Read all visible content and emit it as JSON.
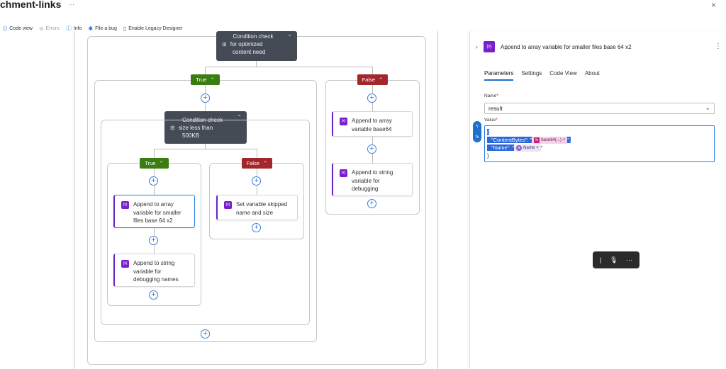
{
  "header": {
    "title": "chment-links",
    "more": "···",
    "close": "×"
  },
  "toolbar": {
    "code_view": "Code view",
    "errors": "Errors",
    "info": "Info",
    "file_bug": "File a bug",
    "legacy": "Enable Legacy Designer"
  },
  "canvas": {
    "cond_optimized": [
      "Condition check",
      "for optimized",
      "content need"
    ],
    "cond_size": [
      "Condition check",
      "size less than",
      "500KB"
    ],
    "badge_true": "True",
    "badge_false": "False",
    "append_array_base64": [
      "Append to array",
      "variable base64"
    ],
    "append_string_debugging": [
      "Append to string",
      "variable for",
      "debugging"
    ],
    "append_smaller": [
      "Append to array",
      "variable for smaller",
      "files base 64 x2"
    ],
    "append_debugging_names": [
      "Append to string",
      "variable for",
      "debugging names"
    ],
    "set_skipped": [
      "Set variable skipped",
      "name and size"
    ],
    "var_icon": "{x}",
    "cond_icon": "⊞"
  },
  "panel": {
    "title": "Append to array variable for smaller files base 64 x2",
    "icon": "{x}",
    "tabs": [
      "Parameters",
      "Settings",
      "Code View",
      "About"
    ],
    "name_label": "Name",
    "name_value": "result",
    "value_label": "Value",
    "value_lines": {
      "open": "{",
      "content_key": "\"ContentBytes\": \"",
      "content_token": "base64(...)",
      "content_end": "\",",
      "name_key": "\"Name\": \"",
      "name_token": "Name",
      "name_end": "\"",
      "close": "}"
    }
  },
  "colors": {
    "true": "#3b7d12",
    "false": "#a4262c",
    "accent": "#1f6fd0",
    "variable": "#7a1fcc"
  }
}
